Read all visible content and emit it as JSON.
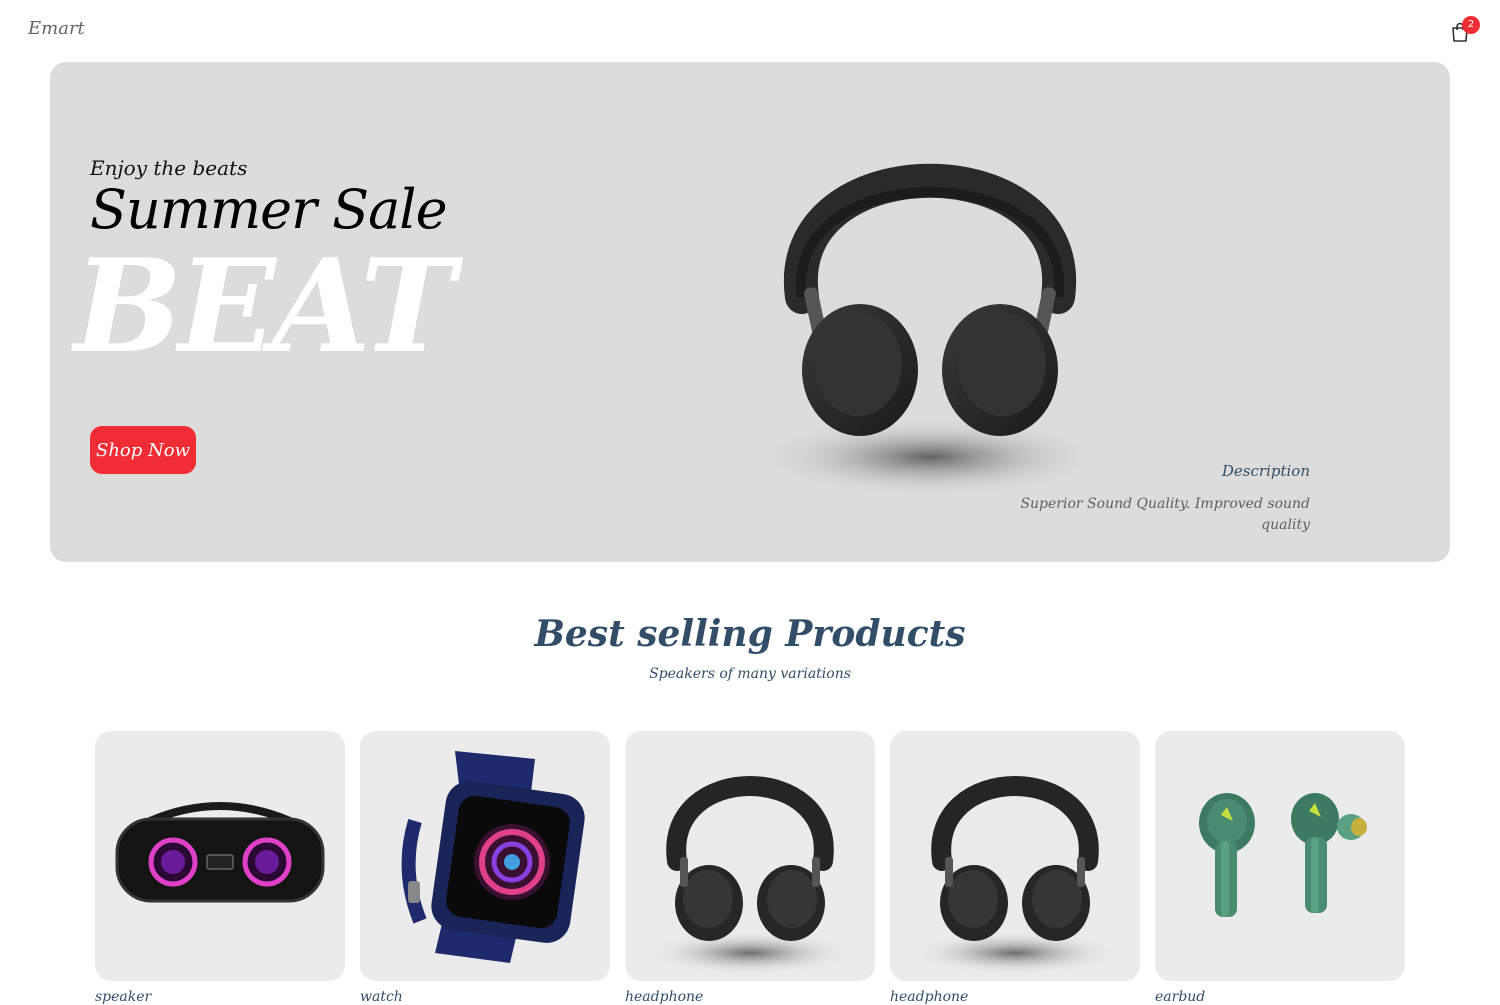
{
  "nav": {
    "logo": "Emart",
    "cart_count": "2",
    "cart_icon": "shopping-bag-icon"
  },
  "hero": {
    "small_text": "Enjoy the beats",
    "mid_text": "Summer Sale",
    "large_text": "BEAT",
    "button_label": "Shop Now",
    "desc_title": "Description",
    "desc_text": "Superior Sound Quality. Improved sound quality",
    "product_image": "headphones"
  },
  "section": {
    "title": "Best selling Products",
    "subtitle": "Speakers of many variations"
  },
  "products": [
    {
      "name": "speaker",
      "image": "speaker"
    },
    {
      "name": "watch",
      "image": "watch"
    },
    {
      "name": "headphone",
      "image": "headphones"
    },
    {
      "name": "headphone",
      "image": "headphones"
    },
    {
      "name": "earbud",
      "image": "earbuds"
    }
  ],
  "colors": {
    "accent": "#f02d34",
    "heading": "#324d67",
    "hero_bg": "#dcdcdc",
    "card_bg": "#ebebeb"
  }
}
